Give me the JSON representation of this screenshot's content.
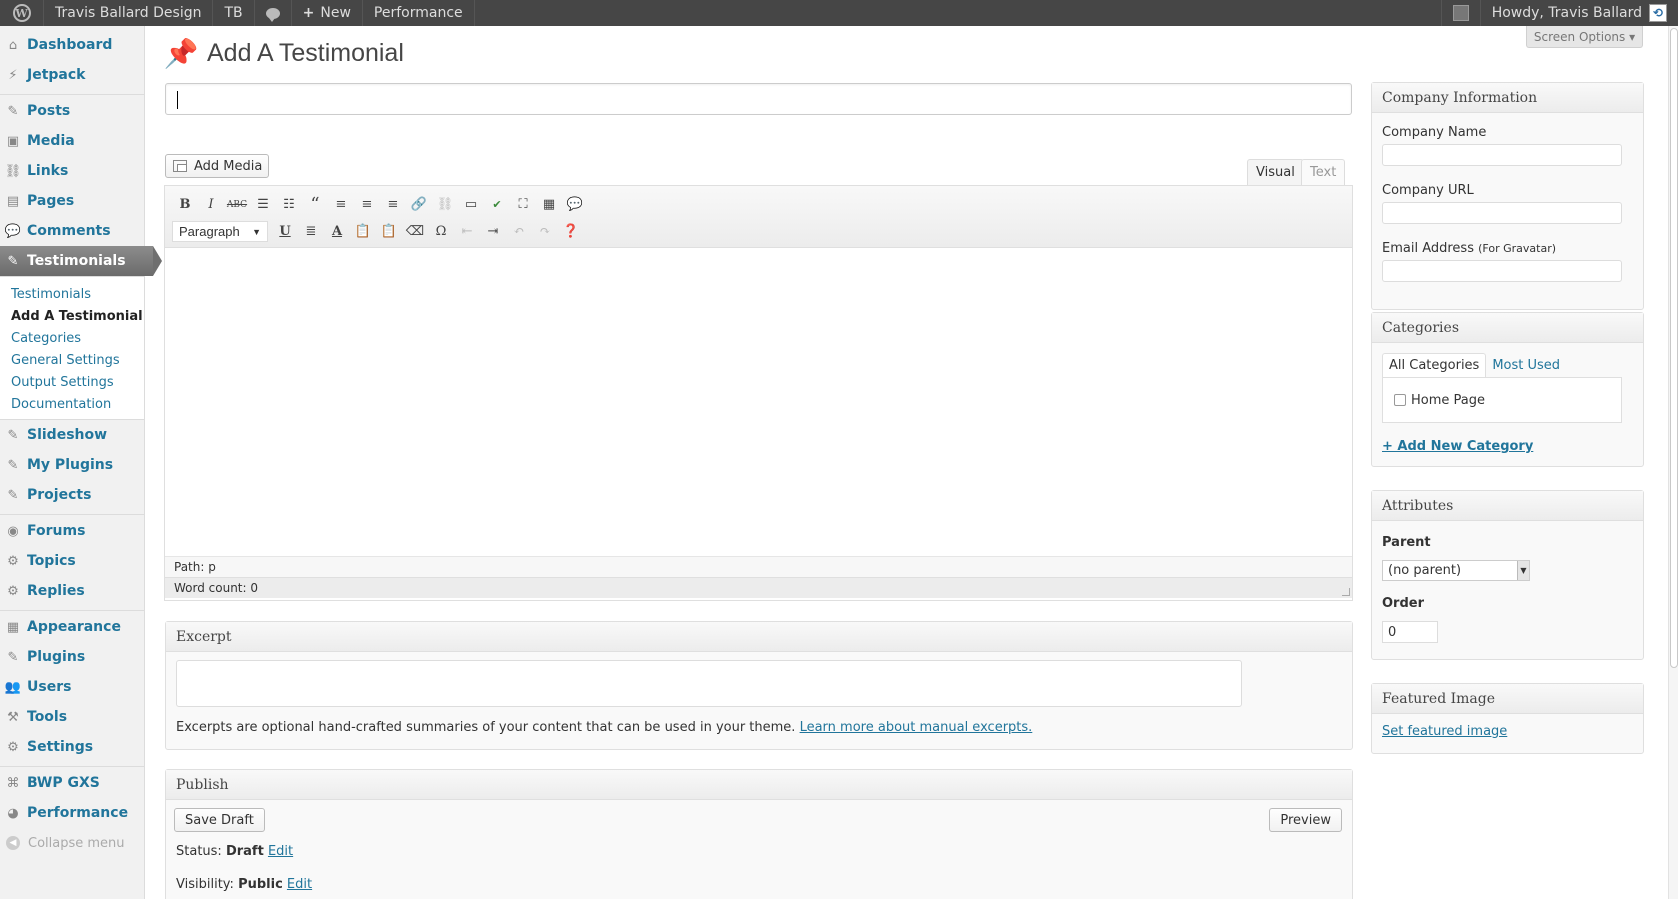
{
  "adminbar": {
    "site_name": "Travis Ballard Design",
    "tb": "TB",
    "new_label": "New",
    "performance": "Performance",
    "howdy": "Howdy, Travis Ballard"
  },
  "sidebar": {
    "items": [
      {
        "label": "Dashboard",
        "icon": "⌂"
      },
      {
        "label": "Jetpack",
        "icon": "⚡"
      },
      {
        "label": "Posts",
        "icon": "✎"
      },
      {
        "label": "Media",
        "icon": "▣"
      },
      {
        "label": "Links",
        "icon": "⛓"
      },
      {
        "label": "Pages",
        "icon": "▤"
      },
      {
        "label": "Comments",
        "icon": "💬"
      },
      {
        "label": "Testimonials",
        "icon": "✎"
      },
      {
        "label": "Slideshow",
        "icon": "✎"
      },
      {
        "label": "My Plugins",
        "icon": "✎"
      },
      {
        "label": "Projects",
        "icon": "✎"
      },
      {
        "label": "Forums",
        "icon": "◉"
      },
      {
        "label": "Topics",
        "icon": "⚙"
      },
      {
        "label": "Replies",
        "icon": "⚙"
      },
      {
        "label": "Appearance",
        "icon": "▦"
      },
      {
        "label": "Plugins",
        "icon": "✎"
      },
      {
        "label": "Users",
        "icon": "👥"
      },
      {
        "label": "Tools",
        "icon": "⚒"
      },
      {
        "label": "Settings",
        "icon": "⚙"
      },
      {
        "label": "BWP GXS",
        "icon": "⌘"
      },
      {
        "label": "Performance",
        "icon": "◕"
      }
    ],
    "submenu": [
      "Testimonials",
      "Add A Testimonial",
      "Categories",
      "General Settings",
      "Output Settings",
      "Documentation"
    ],
    "collapse": "Collapse menu"
  },
  "page": {
    "title": "Add A Testimonial",
    "screen_options": "Screen Options ▾",
    "add_media": "Add Media",
    "tab_visual": "Visual",
    "tab_text": "Text",
    "format_select": "Paragraph",
    "path": "Path: p",
    "word_count": "Word count: 0"
  },
  "excerpt": {
    "title": "Excerpt",
    "help": "Excerpts are optional hand-crafted summaries of your content that can be used in your theme.",
    "link": "Learn more about manual excerpts."
  },
  "publish": {
    "title": "Publish",
    "save_draft": "Save Draft",
    "preview": "Preview",
    "status_label": "Status:",
    "status_value": "Draft",
    "visibility_label": "Visibility:",
    "visibility_value": "Public",
    "edit": "Edit"
  },
  "company": {
    "title": "Company Information",
    "name_label": "Company Name",
    "url_label": "Company URL",
    "email_label": "Email Address",
    "email_note": "(For Gravatar)"
  },
  "categories": {
    "title": "Categories",
    "tab_all": "All Categories",
    "tab_most": "Most Used",
    "item": "Home Page",
    "add_new": "+ Add New Category"
  },
  "attributes": {
    "title": "Attributes",
    "parent_label": "Parent",
    "parent_value": "(no parent)",
    "order_label": "Order",
    "order_value": "0"
  },
  "featured": {
    "title": "Featured Image",
    "link": "Set featured image"
  }
}
